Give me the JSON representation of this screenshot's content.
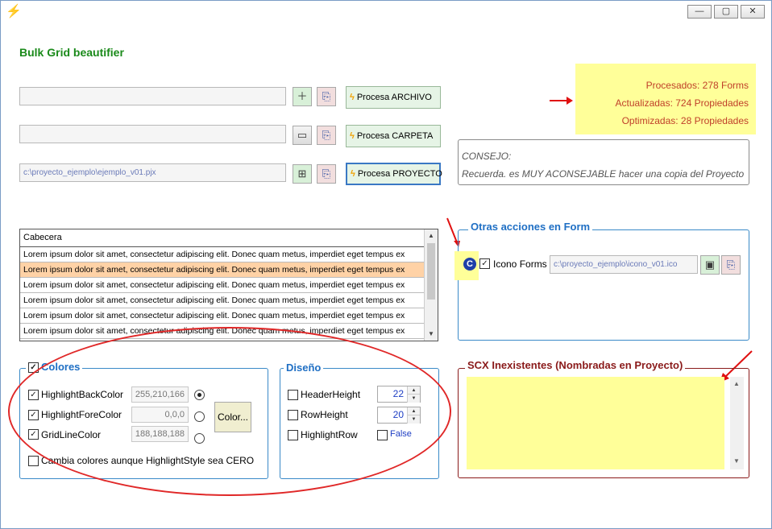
{
  "app_title": "Bulk Grid beautifier",
  "window_buttons": {
    "minimize": "—",
    "maximize": "▢",
    "close": "✕"
  },
  "paths": {
    "archivo": "",
    "carpeta": "",
    "proyecto": "c:\\proyecto_ejemplo\\ejemplo_v01.pjx"
  },
  "buttons": {
    "procesa_archivo": "Procesa ARCHIVO",
    "procesa_carpeta": "Procesa CARPETA",
    "procesa_proyecto": "Procesa PROYECTO",
    "color": "Color..."
  },
  "stats": {
    "procesados": "Procesados: 278 Forms",
    "actualizadas": "Actualizadas: 724 Propiedades",
    "optimizadas": "Optimizadas: 28 Propiedades"
  },
  "consejo": {
    "title": "CONSEJO:",
    "text": "Recuerda. es MUY ACONSEJABLE hacer una copia del Proyecto"
  },
  "grid": {
    "header": "Cabecera",
    "rows": [
      "Lorem ipsum dolor sit amet, consectetur adipiscing elit. Donec quam metus, imperdiet eget tempus ex",
      "Lorem ipsum dolor sit amet, consectetur adipiscing elit. Donec quam metus, imperdiet eget tempus ex",
      "Lorem ipsum dolor sit amet, consectetur adipiscing elit. Donec quam metus, imperdiet eget tempus ex",
      "Lorem ipsum dolor sit amet, consectetur adipiscing elit. Donec quam metus, imperdiet eget tempus ex",
      "Lorem ipsum dolor sit amet, consectetur adipiscing elit. Donec quam metus, imperdiet eget tempus ex",
      "Lorem ipsum dolor sit amet, consectetur adipiscing elit. Donec quam metus, imperdiet eget tempus ex"
    ],
    "highlighted_row": 1
  },
  "otras_acciones": {
    "title": "Otras acciones en Form",
    "icono_label": "Icono Forms",
    "icono_path": "c:\\proyecto_ejemplo\\icono_v01.ico"
  },
  "colores": {
    "title": "Colores",
    "back_label": "HighlightBackColor",
    "back_value": "255,210,166",
    "fore_label": "HighlightForeColor",
    "fore_value": "0,0,0",
    "grid_label": "GridLineColor",
    "grid_value": "188,188,188",
    "cambia_label": "Cambia colores aunque HighlightStyle sea CERO"
  },
  "diseno": {
    "title": "Diseño",
    "header_label": "HeaderHeight",
    "header_value": "22",
    "row_label": "RowHeight",
    "row_value": "20",
    "highlight_label": "HighlightRow",
    "false_label": "False"
  },
  "scx": {
    "title": "SCX Inexistentes (Nombradas en Proyecto)"
  },
  "colors": {
    "accent_blue": "#1f6fc4",
    "title_green": "#1a8a1a",
    "stats_red": "#c0402a",
    "highlight_yellow": "#ffff99",
    "row_highlight": "#ffd2a6"
  }
}
